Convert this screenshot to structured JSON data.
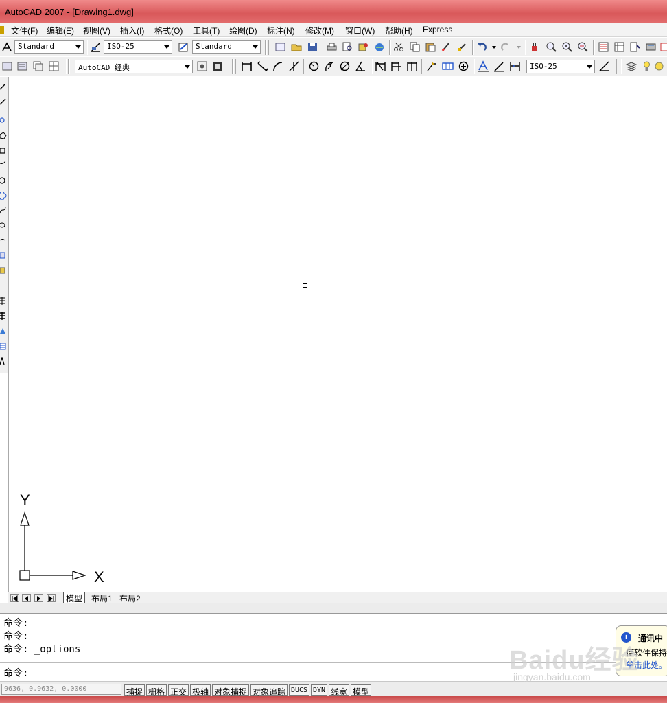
{
  "window": {
    "title": "AutoCAD 2007 - [Drawing1.dwg]"
  },
  "menubar": {
    "items": [
      "文件(F)",
      "编辑(E)",
      "视图(V)",
      "插入(I)",
      "格式(O)",
      "工具(T)",
      "绘图(D)",
      "标注(N)",
      "修改(M)",
      "窗口(W)",
      "帮助(H)",
      "Express"
    ]
  },
  "toolbar1": {
    "text_style": "Standard",
    "dim_style": "ISO-25",
    "table_style": "Standard"
  },
  "toolbar2": {
    "workspace": "AutoCAD 经典",
    "dim_style": "ISO-25"
  },
  "ucs": {
    "x_label": "X",
    "y_label": "Y"
  },
  "layout_tabs": [
    "模型",
    "布局1",
    "布局2"
  ],
  "command_history": [
    "命令:",
    "命令:",
    "命令: _options"
  ],
  "command_prompt": "命令:",
  "status": {
    "coords": "9636, 0.9632, 0.0000",
    "buttons": [
      "捕捉",
      "栅格",
      "正交",
      "极轴",
      "对象捕捉",
      "对象追踪",
      "DUCS",
      "DYN",
      "线宽",
      "模型"
    ]
  },
  "balloon": {
    "title": "通讯中",
    "line1": "使软件保持",
    "link": "单击此处。"
  },
  "watermark": {
    "logo": "Baidu经验",
    "url": "jingyan.baidu.com"
  },
  "colors": {
    "titlebar": "#d9585a",
    "accent": "#2255cc"
  },
  "icons": [
    "text-style-icon",
    "dim-style-icon",
    "table-style-icon",
    "new-icon",
    "open-icon",
    "save-icon",
    "plot-icon",
    "preview-icon",
    "publish-icon",
    "cut-icon",
    "copy-icon",
    "paste-icon",
    "matchprop-icon",
    "undo-icon",
    "redo-icon",
    "pan-icon",
    "zoom-icon",
    "properties-icon",
    "layer-icon",
    "ucs-icon"
  ]
}
